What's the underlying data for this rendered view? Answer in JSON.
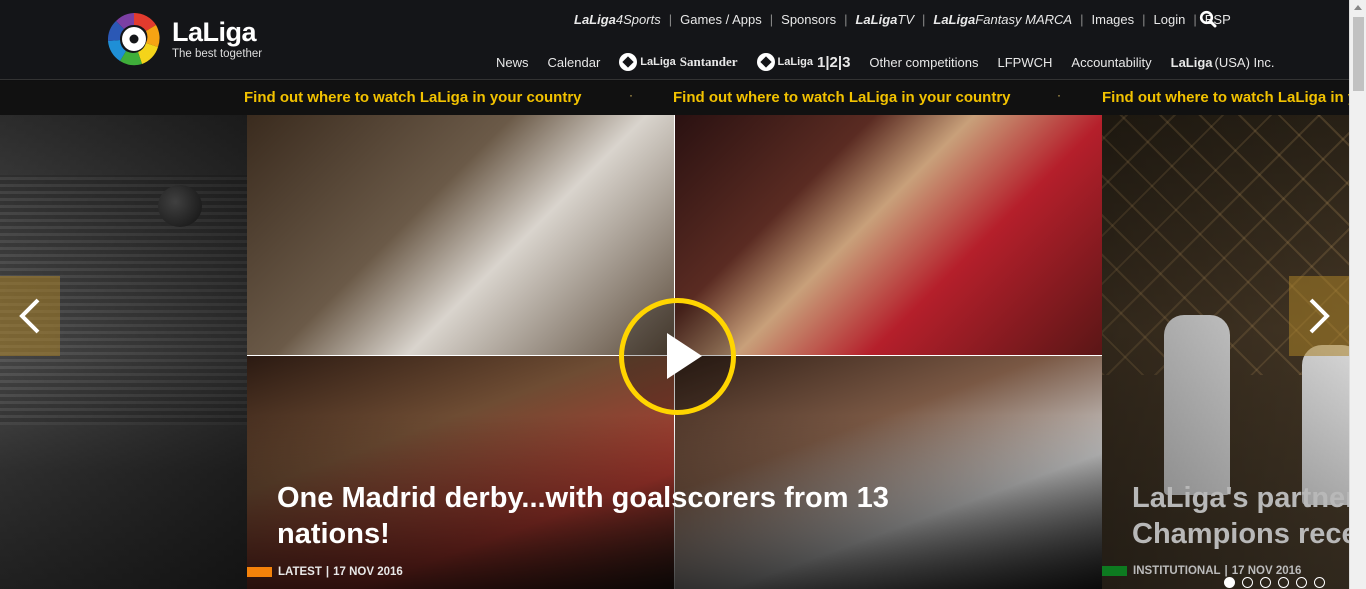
{
  "header": {
    "logo_title": "LaLiga",
    "logo_tagline": "The best together",
    "top_links": [
      {
        "label_bold": "LaLiga",
        "label_rest": "4Sports",
        "style": "brand"
      },
      {
        "label": "Games / Apps"
      },
      {
        "label": "Sponsors"
      },
      {
        "label_bold": "LaLiga",
        "label_rest": "TV",
        "style": "brand"
      },
      {
        "label_bold": "LaLiga",
        "label_rest": "Fantasy MARCA",
        "style": "brand"
      },
      {
        "label": "Images"
      },
      {
        "label": "Login"
      },
      {
        "label": "ESP"
      }
    ],
    "search_icon": "search-icon",
    "main_nav": {
      "news": "News",
      "calendar": "Calendar",
      "santander_brand": "LaLiga",
      "santander_sponsor": "Santander",
      "liga123_brand": "LaLiga",
      "liga123_number": "1|2|3",
      "other": "Other competitions",
      "lfpwch": "LFPWCH",
      "accountability": "Accountability",
      "usa_brand": "LaLiga",
      "usa_rest": "(USA) Inc."
    }
  },
  "ticker": {
    "message": "Find out where to watch LaLiga in your country",
    "separator": "·"
  },
  "slider": {
    "current": {
      "title": "One Madrid derby...with goalscorers from 13 nations!",
      "tag": "LATEST",
      "date": "17 NOV 2016",
      "tag_color": "#f5820a"
    },
    "next": {
      "title_line1": "LaLiga's partner",
      "title_line2": "Champions rece",
      "tag": "INSTITUTIONAL",
      "date": "17 NOV 2016",
      "tag_color": "#0d7a20"
    },
    "play_color": "#ffd500",
    "dots_total": 6,
    "dots_active": 1
  },
  "colors": {
    "ticker_text": "#f2c200",
    "header_bg": "#141518"
  }
}
